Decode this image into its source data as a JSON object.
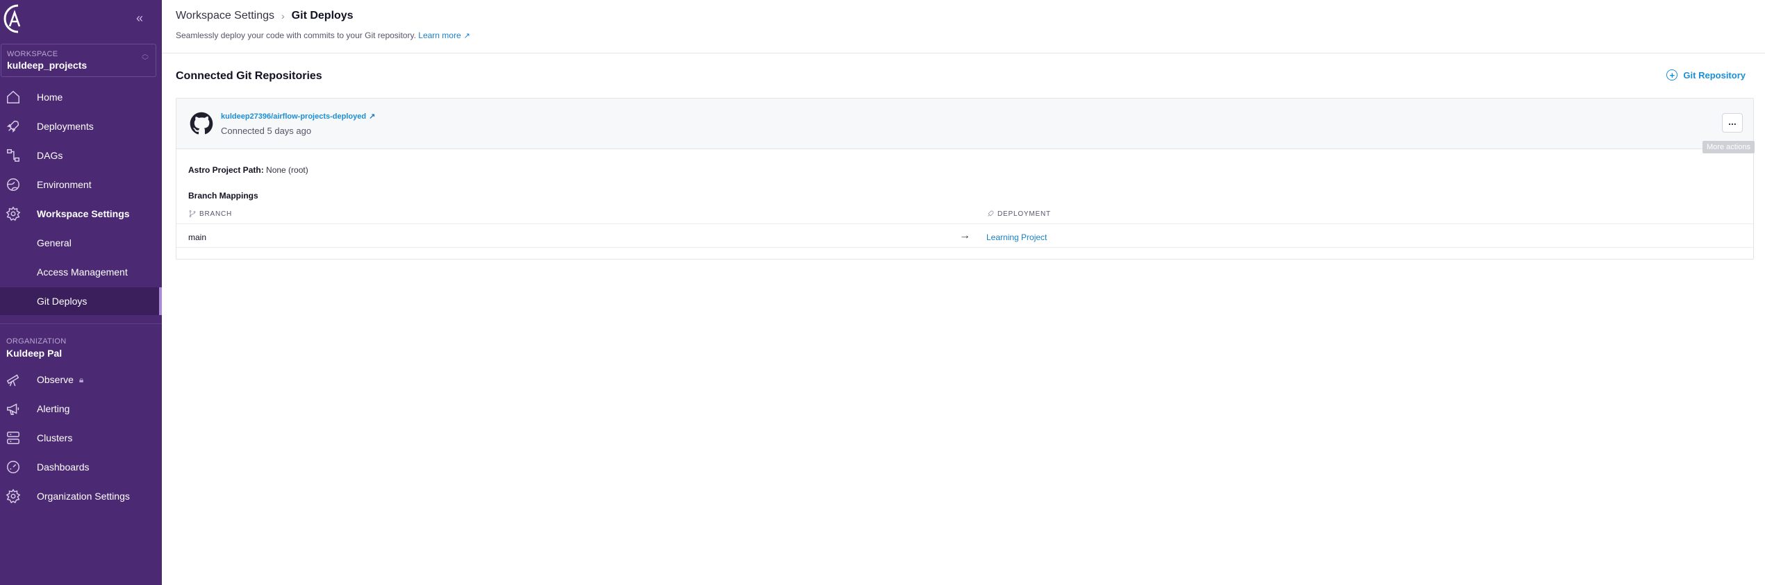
{
  "sidebar": {
    "workspace_label": "WORKSPACE",
    "workspace_name": "kuldeep_projects",
    "nav": [
      {
        "label": "Home",
        "icon": "home-icon"
      },
      {
        "label": "Deployments",
        "icon": "rocket-icon"
      },
      {
        "label": "DAGs",
        "icon": "dags-icon"
      },
      {
        "label": "Environment",
        "icon": "globe-icon"
      },
      {
        "label": "Workspace Settings",
        "icon": "gear-icon"
      }
    ],
    "sub_nav": [
      {
        "label": "General"
      },
      {
        "label": "Access Management"
      },
      {
        "label": "Git Deploys"
      }
    ],
    "org_label": "ORGANIZATION",
    "org_name": "Kuldeep Pal",
    "org_nav": [
      {
        "label": "Observe",
        "icon": "telescope-icon"
      },
      {
        "label": "Alerting",
        "icon": "megaphone-icon"
      },
      {
        "label": "Clusters",
        "icon": "server-icon"
      },
      {
        "label": "Dashboards",
        "icon": "dashboard-icon"
      },
      {
        "label": "Organization Settings",
        "icon": "gear-icon"
      }
    ]
  },
  "header": {
    "breadcrumb_parent": "Workspace Settings",
    "breadcrumb_current": "Git Deploys",
    "subtitle": "Seamlessly deploy your code with commits to your Git repository.",
    "learn_more": "Learn more"
  },
  "main": {
    "section_title": "Connected Git Repositories",
    "add_button": "Git Repository",
    "repo": {
      "name": "kuldeep27396/airflow-projects-deployed",
      "status": "Connected 5 days ago",
      "more_label": "...",
      "tooltip": "More actions",
      "path_label": "Astro Project Path:",
      "path_value": "None (root)",
      "mappings_title": "Branch Mappings",
      "col_branch": "BRANCH",
      "col_deployment": "DEPLOYMENT",
      "rows": [
        {
          "branch": "main",
          "deployment": "Learning Project"
        }
      ]
    }
  },
  "colors": {
    "sidebar_bg": "#4b2a73",
    "sidebar_active": "#3a1f5c",
    "accent": "#1a8fd6"
  }
}
